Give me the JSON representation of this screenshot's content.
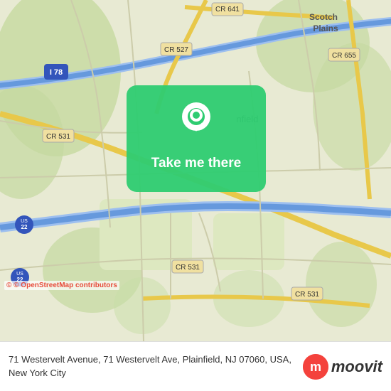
{
  "map": {
    "background_color": "#e8ead3",
    "center_label": "Plainfield",
    "scotch_plains_label": "Scotch\nPlains"
  },
  "roads": [
    {
      "label": "I 78",
      "color": "#5b9af5"
    },
    {
      "label": "CR 641",
      "color": "#f0d060"
    },
    {
      "label": "CR 527",
      "color": "#f0d060"
    },
    {
      "label": "CR 531",
      "color": "#f0d060"
    },
    {
      "label": "CR 655",
      "color": "#f0d060"
    },
    {
      "label": "US 22",
      "color": "#5b9af5"
    },
    {
      "label": "CR 531 (bottom)",
      "color": "#f0d060"
    }
  ],
  "button": {
    "label": "Take me there",
    "background_color": "#2ecc71",
    "text_color": "#ffffff"
  },
  "info_bar": {
    "address": "71 Westervelt Avenue, 71 Westervelt Ave, Plainfield, NJ 07060, USA, New York City",
    "logo_text": "moovit",
    "logo_icon_letter": "m"
  },
  "attribution": {
    "text": "© OpenStreetMap contributors"
  }
}
